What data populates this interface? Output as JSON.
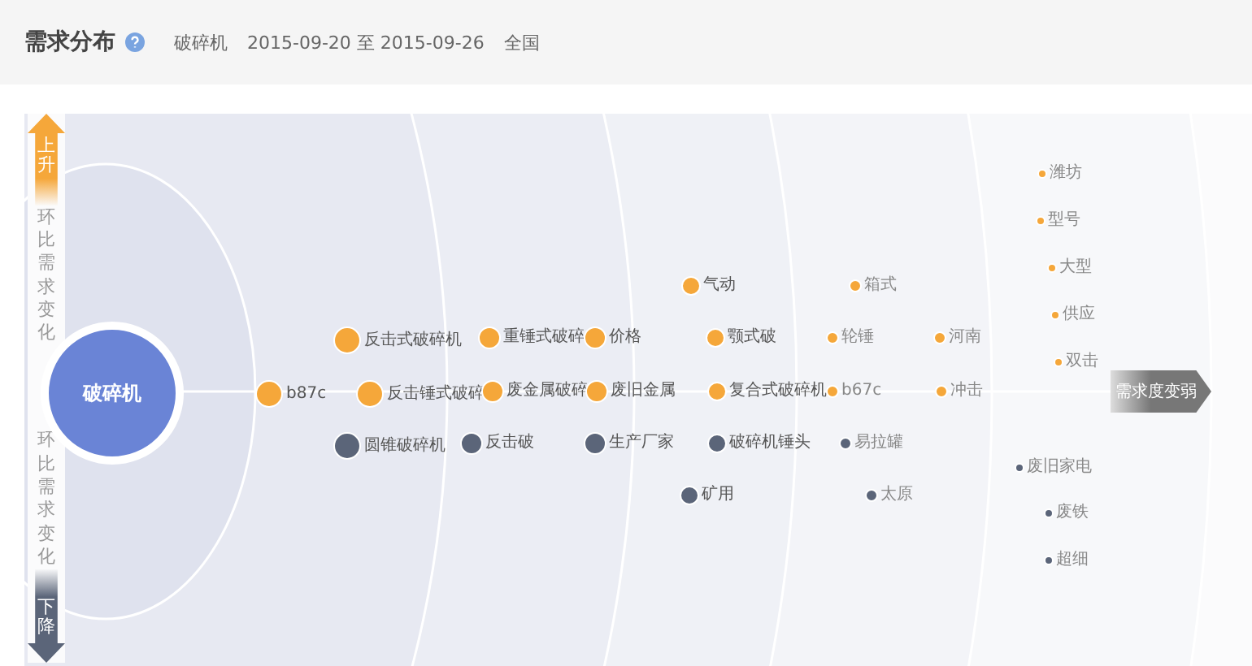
{
  "header": {
    "title": "需求分布",
    "keyword": "破碎机",
    "date_range": "2015-09-20 至 2015-09-26",
    "region": "全国"
  },
  "axis": {
    "up_label": "上升",
    "up_caption": "环比需求变化",
    "down_caption": "环比需求变化",
    "down_label": "下降"
  },
  "center": {
    "label": "破碎机"
  },
  "direction_label": "需求度变弱",
  "rings": [
    {
      "nodes": [
        {
          "label": "b87c",
          "kind": "rise"
        }
      ]
    },
    {
      "nodes": [
        {
          "label": "反击式破碎机",
          "kind": "rise"
        },
        {
          "label": "反击锤式破碎",
          "kind": "rise"
        },
        {
          "label": "圆锥破碎机",
          "kind": "fall"
        }
      ]
    },
    {
      "nodes": [
        {
          "label": "重锤式破碎",
          "kind": "rise"
        },
        {
          "label": "废金属破碎",
          "kind": "rise"
        },
        {
          "label": "反击破",
          "kind": "fall"
        }
      ]
    },
    {
      "nodes": [
        {
          "label": "价格",
          "kind": "rise"
        },
        {
          "label": "废旧金属",
          "kind": "rise"
        },
        {
          "label": "生产厂家",
          "kind": "fall"
        }
      ]
    },
    {
      "nodes": [
        {
          "label": "气动",
          "kind": "rise"
        },
        {
          "label": "颚式破",
          "kind": "rise"
        },
        {
          "label": "复合式破碎机",
          "kind": "rise"
        },
        {
          "label": "破碎机锤头",
          "kind": "fall"
        },
        {
          "label": "矿用",
          "kind": "fall"
        }
      ]
    },
    {
      "nodes": [
        {
          "label": "箱式",
          "kind": "rise"
        },
        {
          "label": "轮锤",
          "kind": "rise"
        },
        {
          "label": "b67c",
          "kind": "rise"
        },
        {
          "label": "易拉罐",
          "kind": "fall"
        },
        {
          "label": "太原",
          "kind": "fall"
        }
      ]
    },
    {
      "nodes": [
        {
          "label": "河南",
          "kind": "rise"
        },
        {
          "label": "冲击",
          "kind": "rise"
        }
      ]
    },
    {
      "nodes": [
        {
          "label": "潍坊",
          "kind": "rise"
        },
        {
          "label": "型号",
          "kind": "rise"
        },
        {
          "label": "大型",
          "kind": "rise"
        },
        {
          "label": "供应",
          "kind": "rise"
        },
        {
          "label": "双击",
          "kind": "rise"
        },
        {
          "label": "废旧家电",
          "kind": "fall"
        },
        {
          "label": "废铁",
          "kind": "fall"
        },
        {
          "label": "超细",
          "kind": "fall"
        }
      ]
    }
  ]
}
